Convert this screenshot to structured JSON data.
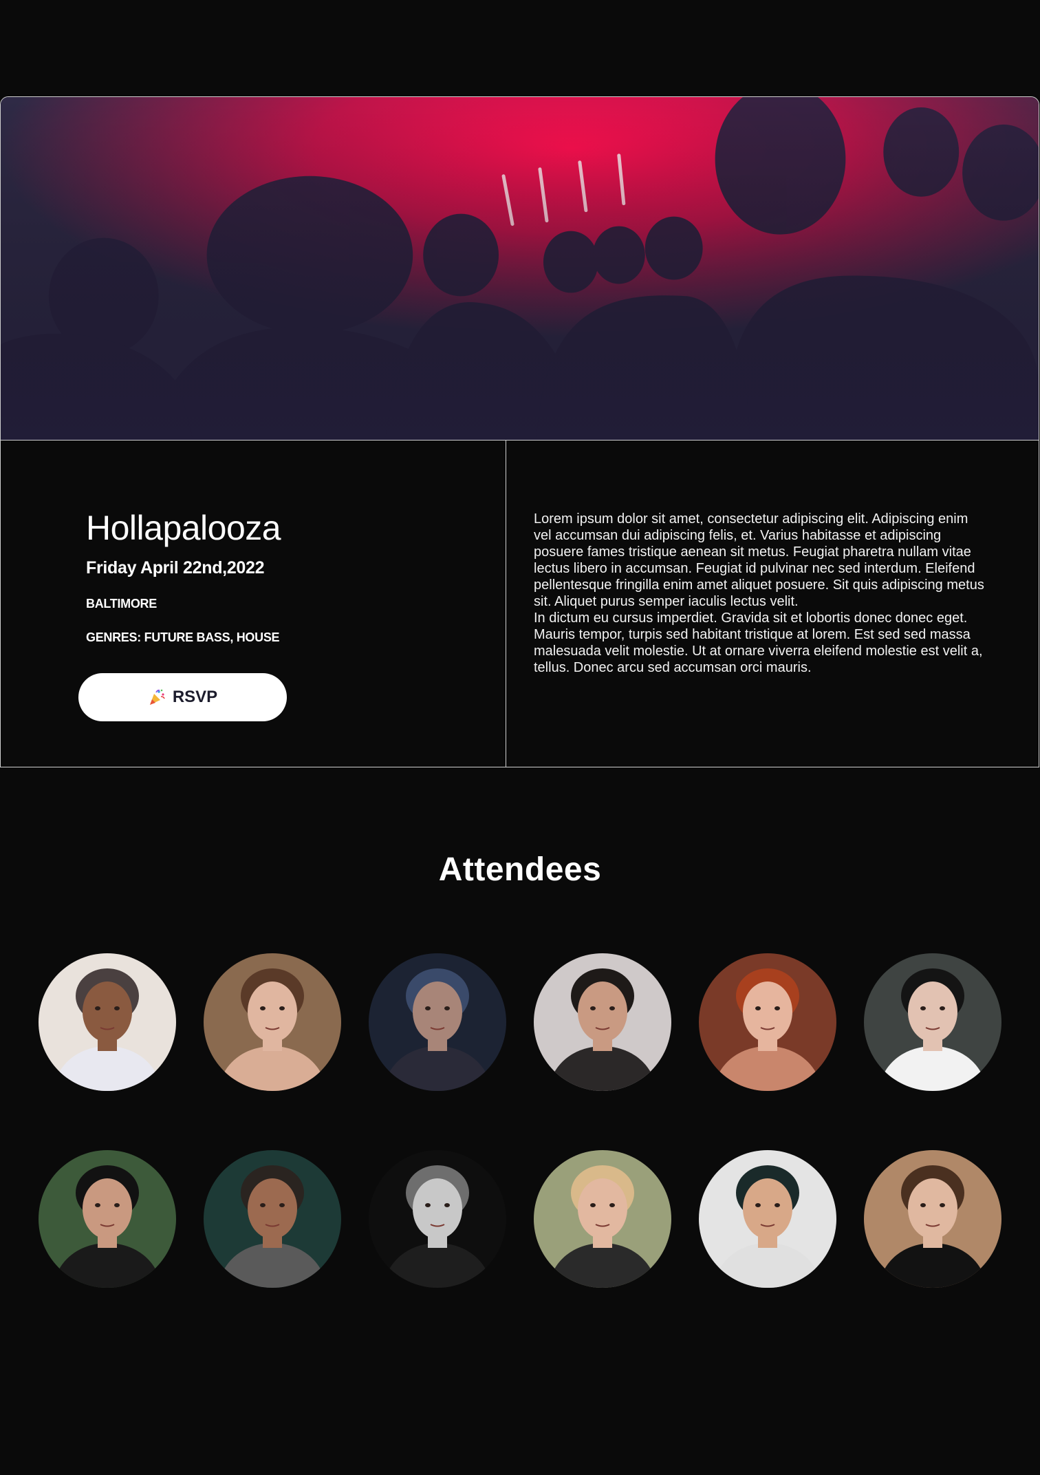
{
  "event": {
    "title": "Hollapalooza",
    "date": "Friday April 22nd,2022",
    "city": "BALTIMORE",
    "genres": "GENRES: FUTURE BASS, HOUSE",
    "rsvp_label": "RSVP",
    "rsvp_icon": "party-popper-icon"
  },
  "description": {
    "paragraphs": [
      "Lorem ipsum dolor sit amet, consectetur adipiscing elit. Adipiscing enim vel accumsan dui adipiscing felis, et. Varius habitasse et adipiscing posuere fames tristique aenean sit metus. Feugiat pharetra nullam vitae lectus libero in accumsan. Feugiat id pulvinar nec sed interdum. Eleifend pellentesque fringilla enim amet aliquet posuere. Sit quis adipiscing metus sit. Aliquet purus semper iaculis lectus velit.",
      "In dictum eu cursus imperdiet. Gravida sit et lobortis donec donec eget. Mauris tempor, turpis sed habitant tristique at lorem. Est sed sed massa malesuada velit molestie. Ut at ornare viverra eleifend molestie est velit a, tellus. Donec arcu sed accumsan orci mauris."
    ]
  },
  "attendees": {
    "title": "Attendees",
    "people": [
      {
        "bg": "#e9e2dc",
        "skin": "#8a5a40",
        "hair": "#4a4040",
        "shirt": "#e8e8f0"
      },
      {
        "bg": "#8a6a4f",
        "skin": "#e0b6a0",
        "hair": "#5a3a28",
        "shirt": "#d9ad95"
      },
      {
        "bg": "#1c2333",
        "skin": "#a88578",
        "hair": "#3a4a6a",
        "shirt": "#2a2a38"
      },
      {
        "bg": "#cfc9c9",
        "skin": "#c99a82",
        "hair": "#1e1a18",
        "shirt": "#2b2828"
      },
      {
        "bg": "#7a3a28",
        "skin": "#e6b59e",
        "hair": "#a8401e",
        "shirt": "#c9866c"
      },
      {
        "bg": "#3f4442",
        "skin": "#e2c2b2",
        "hair": "#141414",
        "shirt": "#f2f2f2"
      },
      {
        "bg": "#3d5a3a",
        "skin": "#c99980",
        "hair": "#121212",
        "shirt": "#1a1a1a"
      },
      {
        "bg": "#1d3a36",
        "skin": "#9c6a50",
        "hair": "#2a2420",
        "shirt": "#5a5a5a"
      },
      {
        "bg": "#0e0e0e",
        "skin": "#c8c8c8",
        "hair": "#6e6e6e",
        "shirt": "#1e1e1e"
      },
      {
        "bg": "#9aa07a",
        "skin": "#e2b8a0",
        "hair": "#d9b98a",
        "shirt": "#2a2a2a"
      },
      {
        "bg": "#e4e4e4",
        "skin": "#d8a888",
        "hair": "#1a2a2a",
        "shirt": "#e0e0e0"
      },
      {
        "bg": "#b08868",
        "skin": "#e0b8a0",
        "hair": "#4a3020",
        "shirt": "#121212"
      }
    ]
  },
  "colors": {
    "background": "#0a0a0a",
    "border": "#cfcfcf",
    "hero_accent": "#ff0a4a",
    "button_bg": "#ffffff",
    "button_text": "#1c1c2c"
  }
}
